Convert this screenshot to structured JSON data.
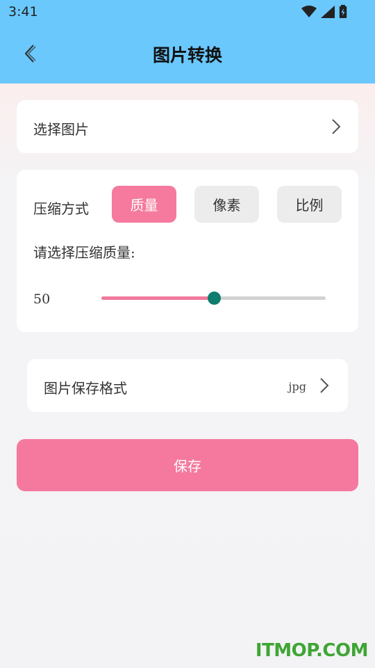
{
  "status_bar": {
    "time": "3:41",
    "icons": [
      "wifi-icon",
      "signal-icon",
      "battery-charging-icon"
    ]
  },
  "header": {
    "title": "图片转换",
    "back_icon": "chevron-left-icon",
    "background_color": "#6ac8fd"
  },
  "select_image": {
    "label": "选择图片",
    "icon": "chevron-right-icon"
  },
  "compression": {
    "label": "压缩方式",
    "modes": [
      {
        "label": "质量",
        "selected": true
      },
      {
        "label": "像素",
        "selected": false
      },
      {
        "label": "比例",
        "selected": false
      }
    ],
    "prompt": "请选择压缩质量:",
    "slider": {
      "value": "50",
      "min": 0,
      "max": 100,
      "fraction": 0.5,
      "fill_color": "#f07a9c",
      "thumb_color": "#0e7c6e"
    }
  },
  "save_format": {
    "label": "图片保存格式",
    "value": "jpg",
    "icon": "chevron-right-icon"
  },
  "save_button": {
    "label": "保存",
    "color": "#f5799e"
  },
  "watermark": {
    "text": "ITMOP.COM"
  }
}
